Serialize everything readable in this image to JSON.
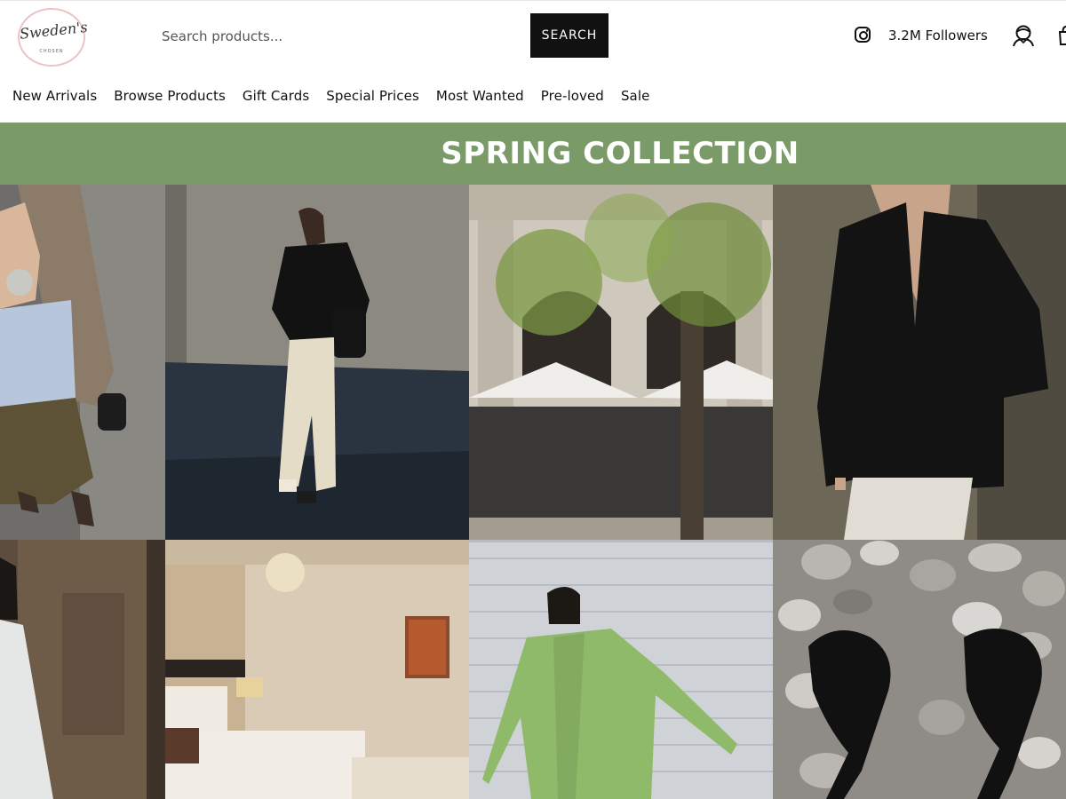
{
  "header": {
    "logo": {
      "text": "Sweden's",
      "sub": "CHOSEN"
    },
    "search": {
      "placeholder": "Search products...",
      "button_label": "SEARCH"
    },
    "social": {
      "icon": "instagram-icon",
      "followers": "3.2M Followers"
    },
    "icons": [
      "account-icon",
      "cart-icon"
    ]
  },
  "nav": {
    "items": [
      {
        "label": "New Arrivals"
      },
      {
        "label": "Browse Products"
      },
      {
        "label": "Gift Cards"
      },
      {
        "label": "Special Prices"
      },
      {
        "label": "Most Wanted"
      },
      {
        "label": "Pre-loved"
      },
      {
        "label": "Sale"
      }
    ]
  },
  "banner": {
    "title": "SPRING COLLECTION",
    "background": "#7a9a67"
  },
  "gallery": {
    "rows": 2,
    "columns": 4,
    "images": [
      {
        "name": "photo-satin-skirt-outfit"
      },
      {
        "name": "photo-black-shirt-cream-jeans"
      },
      {
        "name": "photo-cafe-umbrellas-tree"
      },
      {
        "name": "photo-black-blazer"
      },
      {
        "name": "photo-white-outfit-hallway"
      },
      {
        "name": "photo-bedroom-interior"
      },
      {
        "name": "photo-green-oversized-blazer"
      },
      {
        "name": "photo-black-sandals-pebbles"
      }
    ]
  }
}
